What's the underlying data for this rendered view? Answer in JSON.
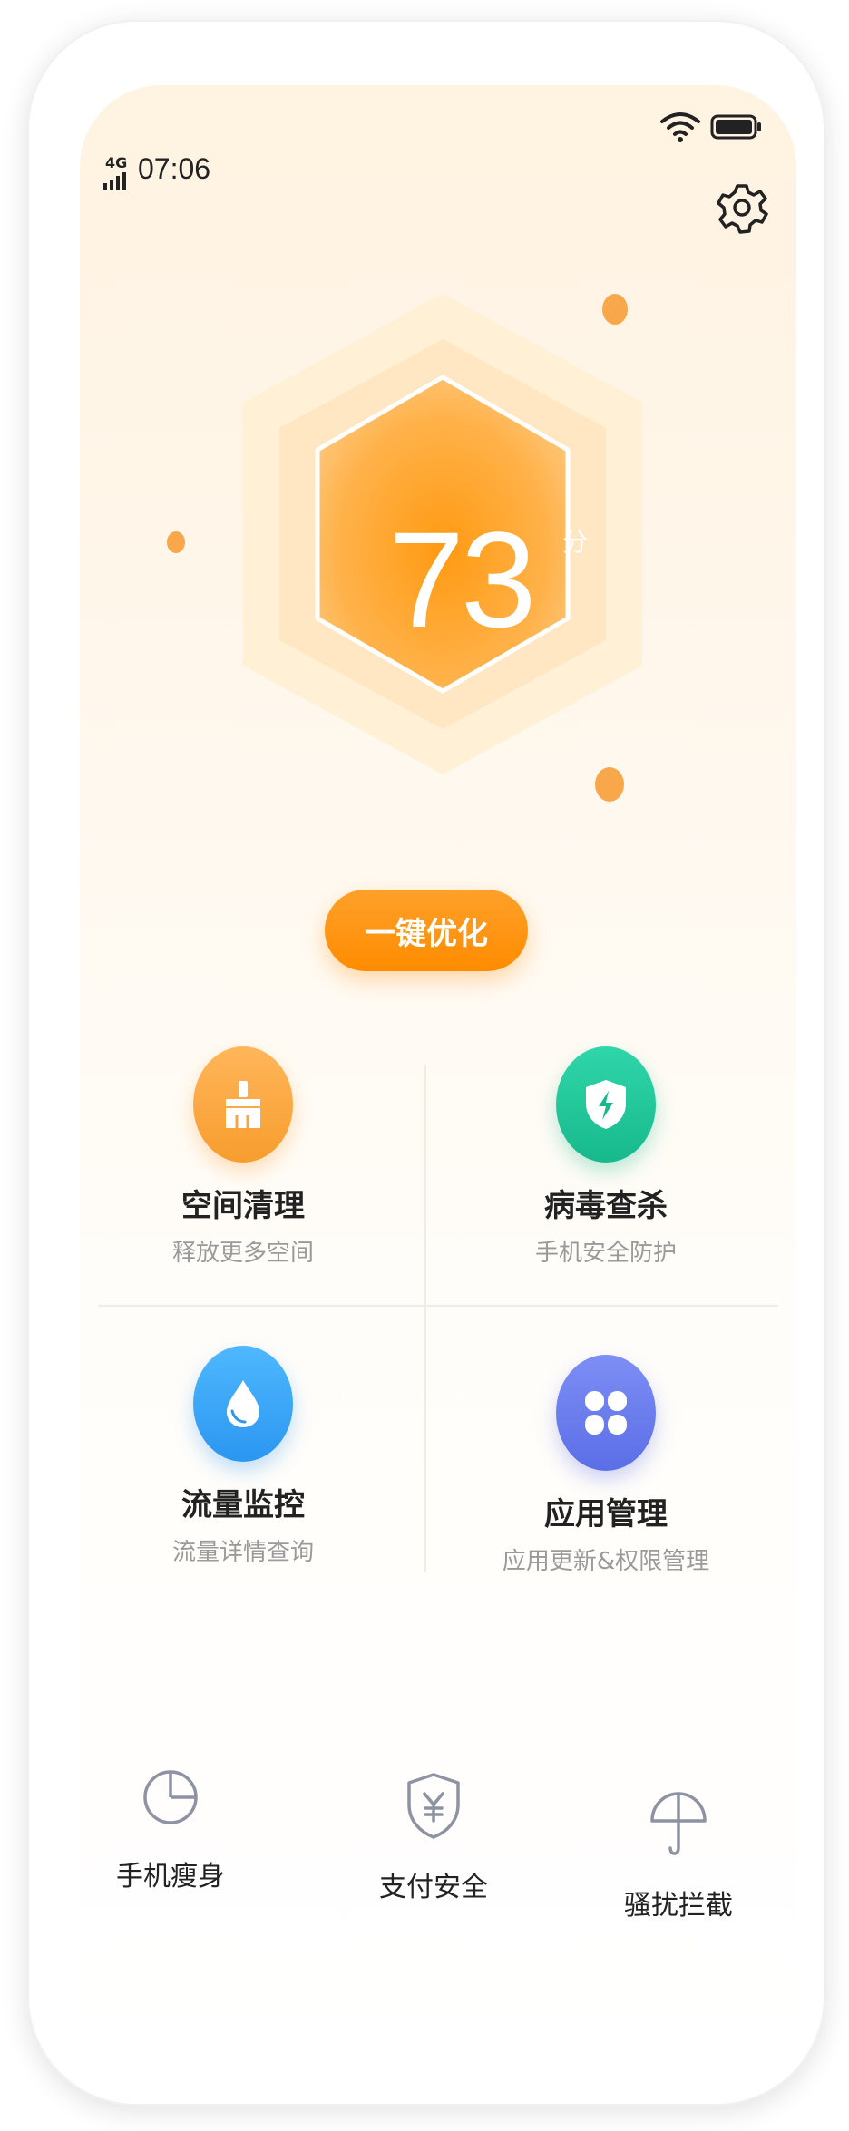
{
  "status_bar": {
    "network": "4G",
    "time": "07:06"
  },
  "header": {
    "settings_icon": "gear-icon"
  },
  "score": {
    "value": "73",
    "unit": "分"
  },
  "optimize_button": {
    "label": "一键优化"
  },
  "features": [
    {
      "title": "空间清理",
      "subtitle": "释放更多空间",
      "icon": "broom-icon",
      "color": "#f9a440"
    },
    {
      "title": "病毒查杀",
      "subtitle": "手机安全防护",
      "icon": "shield-bolt-icon",
      "color": "#22c59c"
    },
    {
      "title": "流量监控",
      "subtitle": "流量详情查询",
      "icon": "water-drop-icon",
      "color": "#3aa8f8"
    },
    {
      "title": "应用管理",
      "subtitle": "应用更新&权限管理",
      "icon": "app-grid-icon",
      "color": "#6b7ff0"
    }
  ],
  "tools": [
    {
      "label": "手机瘦身",
      "icon": "pie-chart-icon"
    },
    {
      "label": "支付安全",
      "icon": "yuan-shield-icon"
    },
    {
      "label": "骚扰拦截",
      "icon": "umbrella-icon"
    }
  ],
  "colors": {
    "accent": "#ff9a1a",
    "icon_gray": "#8e93a3"
  }
}
